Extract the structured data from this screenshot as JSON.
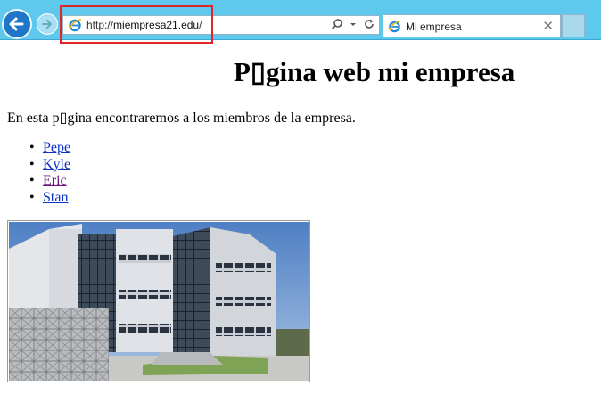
{
  "browser": {
    "address_bar": {
      "url_scheme": "http://",
      "url_host": "miempresa21.edu",
      "url_tail": "/"
    },
    "tab": {
      "title": "Mi empresa"
    },
    "icons": [
      "back-icon",
      "forward-icon",
      "ie-logo-icon",
      "search-icon",
      "dropdown-icon",
      "refresh-icon",
      "close-icon"
    ]
  },
  "page": {
    "title": "P▯gina web mi empresa",
    "intro": "En esta p▯gina encontraremos a los miembros de la empresa.",
    "members": [
      {
        "name": "Pepe",
        "visited": false
      },
      {
        "name": "Kyle",
        "visited": false
      },
      {
        "name": "Eric",
        "visited": true
      },
      {
        "name": "Stan",
        "visited": false
      }
    ]
  },
  "colors": {
    "chrome_bg": "#5ec9ec",
    "link": "#0a31c8",
    "link_visited": "#6c1580",
    "highlight_box": "#e0262b"
  }
}
